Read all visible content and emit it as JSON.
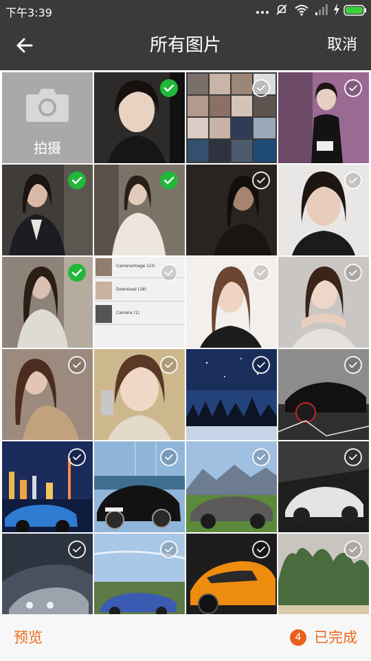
{
  "status_bar": {
    "time": "下午3:39",
    "icons": [
      "more-dots-icon",
      "mute-icon",
      "wifi-icon",
      "signal-icon",
      "charging-icon",
      "battery-icon"
    ],
    "battery_color": "#3ad13a"
  },
  "header": {
    "title": "所有图片",
    "cancel_label": "取消",
    "background": "#3a3a3a"
  },
  "camera_tile": {
    "label": "拍摄",
    "icon": "camera-icon"
  },
  "photos": [
    {
      "subject": "woman portrait, dark background",
      "selected": true
    },
    {
      "subject": "screenshot collage of photos",
      "selected": false
    },
    {
      "subject": "woman in black dress on purple backdrop",
      "selected": false
    },
    {
      "subject": "woman in dark blazer",
      "selected": true
    },
    {
      "subject": "woman in white lace dress",
      "selected": true
    },
    {
      "subject": "woman portrait, dim tones",
      "selected": false
    },
    {
      "subject": "woman portrait close-up",
      "selected": false
    },
    {
      "subject": "woman with long hair",
      "selected": true
    },
    {
      "subject": "album list screenshot",
      "selected": false
    },
    {
      "subject": "woman with long brown hair",
      "selected": false
    },
    {
      "subject": "woman with hands under chin",
      "selected": false
    },
    {
      "subject": "woman in sequin top",
      "selected": false
    },
    {
      "subject": "woman on phone",
      "selected": false
    },
    {
      "subject": "night sky over snowy forest",
      "selected": false
    },
    {
      "subject": "black sports car",
      "selected": false
    },
    {
      "subject": "blue sports car, city skyline",
      "selected": false
    },
    {
      "subject": "black sports car at harbor",
      "selected": false
    },
    {
      "subject": "grey sports car, mountains",
      "selected": false
    },
    {
      "subject": "white sports car",
      "selected": false
    },
    {
      "subject": "silver car at night",
      "selected": false
    },
    {
      "subject": "blue classic car",
      "selected": false
    },
    {
      "subject": "orange sports car",
      "selected": false
    },
    {
      "subject": "tropical cliffs and beach",
      "selected": false
    }
  ],
  "album_screenshot": {
    "rows": [
      "CameraImage (23)",
      "Download (18)",
      "Camera (1)"
    ]
  },
  "footer": {
    "preview_label": "预览",
    "selected_count": "4",
    "done_label": "已完成",
    "accent": "#e86a1c"
  }
}
